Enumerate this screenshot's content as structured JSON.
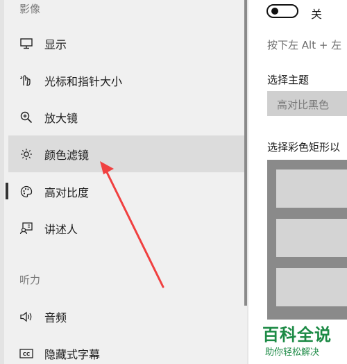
{
  "sidebar": {
    "section_vision": "影像",
    "section_hearing": "听力",
    "items": [
      {
        "label": "显示",
        "icon": "monitor-icon"
      },
      {
        "label": "光标和指针大小",
        "icon": "pointer-hand-icon"
      },
      {
        "label": "放大镜",
        "icon": "magnifier-icon"
      },
      {
        "label": "颜色滤镜",
        "icon": "brightness-icon"
      },
      {
        "label": "高对比度",
        "icon": "palette-icon"
      },
      {
        "label": "讲述人",
        "icon": "narrator-icon"
      },
      {
        "label": "音频",
        "icon": "speaker-icon"
      },
      {
        "label": "隐藏式字幕",
        "icon": "cc-icon"
      }
    ]
  },
  "content": {
    "toggle_state": "关",
    "hint": "按下左 Alt + 左",
    "theme_label": "选择主题",
    "theme_value": "高对比黑色",
    "color_label": "选择彩色矩形以"
  },
  "watermark": {
    "title": "百科全说",
    "subtitle": "助你轻松解决"
  },
  "colors": {
    "arrow": "#f04040",
    "watermark": "#1c8a45"
  }
}
